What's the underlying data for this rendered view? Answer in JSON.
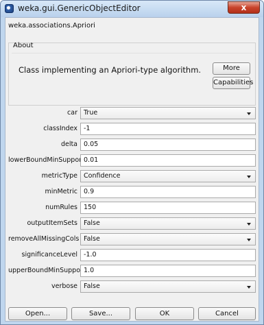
{
  "window": {
    "title": "weka.gui.GenericObjectEditor",
    "close_glyph": "x"
  },
  "classname": "weka.associations.Apriori",
  "about": {
    "legend": "About",
    "text": "Class implementing an Apriori-type algorithm.",
    "more_label": "More",
    "capabilities_label": "Capabilities"
  },
  "properties": [
    {
      "label": "car",
      "value": "True",
      "kind": "select"
    },
    {
      "label": "classIndex",
      "value": "-1",
      "kind": "text"
    },
    {
      "label": "delta",
      "value": "0.05",
      "kind": "text"
    },
    {
      "label": "lowerBoundMinSupport",
      "value": "0.01",
      "kind": "text"
    },
    {
      "label": "metricType",
      "value": "Confidence",
      "kind": "select"
    },
    {
      "label": "minMetric",
      "value": "0.9",
      "kind": "text"
    },
    {
      "label": "numRules",
      "value": "150",
      "kind": "text"
    },
    {
      "label": "outputItemSets",
      "value": "False",
      "kind": "select"
    },
    {
      "label": "removeAllMissingCols",
      "value": "False",
      "kind": "select"
    },
    {
      "label": "significanceLevel",
      "value": "-1.0",
      "kind": "text"
    },
    {
      "label": "upperBoundMinSupport",
      "value": "1.0",
      "kind": "text"
    },
    {
      "label": "verbose",
      "value": "False",
      "kind": "select"
    }
  ],
  "buttons": {
    "open": "Open...",
    "save": "Save...",
    "ok": "OK",
    "cancel": "Cancel"
  },
  "colors": {
    "title_gradient_top": "#d8e8f8",
    "close_red": "#c8432b",
    "panel_bg": "#f0f0f0"
  }
}
